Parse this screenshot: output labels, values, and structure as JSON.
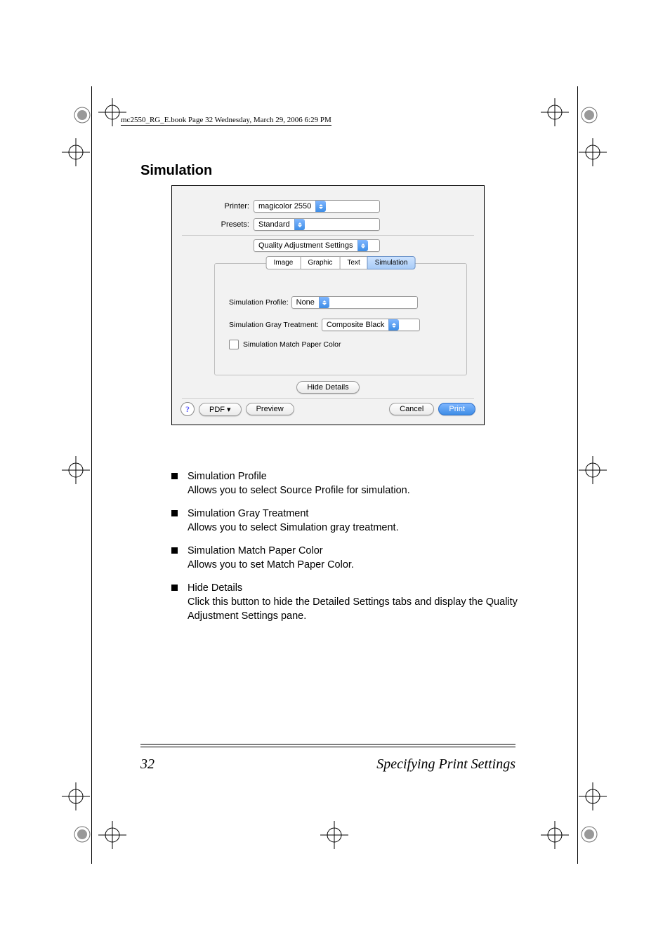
{
  "header": "mc2550_RG_E.book  Page 32  Wednesday, March 29, 2006  6:29 PM",
  "section_title": "Simulation",
  "dialog": {
    "printer_label": "Printer:",
    "printer_value": "magicolor 2550",
    "presets_label": "Presets:",
    "presets_value": "Standard",
    "pane_select": "Quality Adjustment Settings",
    "tabs": [
      "Image",
      "Graphic",
      "Text",
      "Simulation"
    ],
    "active_tab": 3,
    "sim_profile_label": "Simulation Profile:",
    "sim_profile_value": "None",
    "sim_gray_label": "Simulation Gray Treatment:",
    "sim_gray_value": "Composite Black",
    "sim_match_label": "Simulation Match Paper Color",
    "hide_details_btn": "Hide Details",
    "help_glyph": "?",
    "pdf_btn": "PDF ▾",
    "preview_btn": "Preview",
    "cancel_btn": "Cancel",
    "print_btn": "Print"
  },
  "bullets": [
    {
      "title": "Simulation Profile",
      "desc": "Allows you to select Source Profile for simulation."
    },
    {
      "title": "Simulation Gray Treatment",
      "desc": "Allows you to select Simulation gray treatment."
    },
    {
      "title": "Simulation Match Paper Color",
      "desc": "Allows you to set Match Paper Color."
    },
    {
      "title": "Hide Details",
      "desc": "Click this button to hide the Detailed Settings tabs and display the Quality Adjustment Settings pane."
    }
  ],
  "footer": {
    "page_num": "32",
    "title": "Specifying Print Settings"
  }
}
